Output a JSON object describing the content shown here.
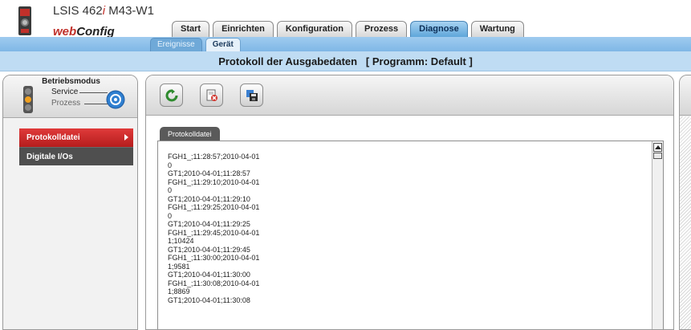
{
  "header": {
    "device_prefix": "LSIS 462",
    "device_accent": "i",
    "device_suffix": " M43-W1",
    "brand_web": "web",
    "brand_config": "Config"
  },
  "tabs": [
    {
      "label": "Start",
      "active": false
    },
    {
      "label": "Einrichten",
      "active": false
    },
    {
      "label": "Konfiguration",
      "active": false
    },
    {
      "label": "Prozess",
      "active": false
    },
    {
      "label": "Diagnose",
      "active": true
    },
    {
      "label": "Wartung",
      "active": false
    }
  ],
  "subtabs": [
    {
      "label": "Ereignisse",
      "active": false
    },
    {
      "label": "Gerät",
      "active": true
    }
  ],
  "page_title": "Protokoll der Ausgabedaten   [ Programm: Default ]",
  "mode": {
    "title": "Betriebsmodus",
    "service": "Service",
    "process": "Prozess"
  },
  "nav": [
    {
      "label": "Protokolldatei",
      "active": true
    },
    {
      "label": "Digitale I/Os",
      "active": false
    }
  ],
  "toolbar": {
    "refresh_icon": "refresh-icon",
    "delete_icon": "delete-log-icon",
    "save_icon": "save-icon"
  },
  "content_tab": "Protokolldatei",
  "log_lines": [
    "FGH1_;11:28:57;2010-04-01",
    "0",
    "GT1;2010-04-01;11:28:57",
    "FGH1_;11:29:10;2010-04-01",
    "0",
    "GT1;2010-04-01;11:29:10",
    "FGH1_;11:29:25;2010-04-01",
    "0",
    "GT1;2010-04-01;11:29:25",
    "FGH1_;11:29:45;2010-04-01",
    "1;10424",
    "GT1;2010-04-01;11:29:45",
    "FGH1_;11:30:00;2010-04-01",
    "1;9581",
    "GT1;2010-04-01;11:30:00",
    "FGH1_;11:30:08;2010-04-01",
    "1;8869",
    "GT1;2010-04-01;11:30:08"
  ],
  "colors": {
    "accent_blue": "#5fa6da",
    "active_nav_red": "#c62828",
    "title_bar": "#bfdcf3"
  }
}
